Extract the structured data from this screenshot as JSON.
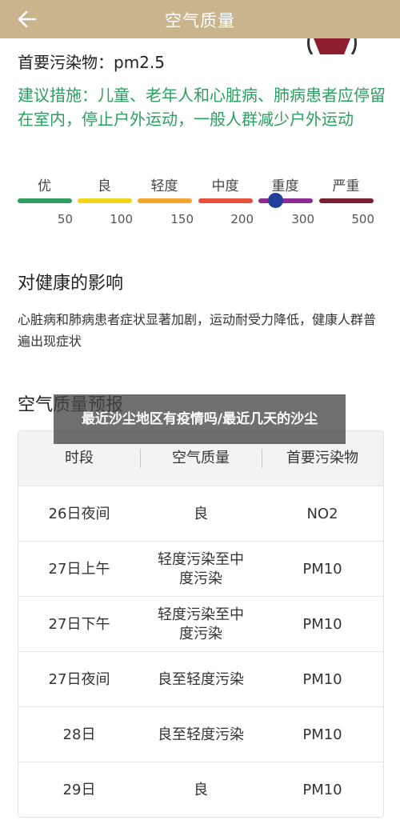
{
  "header": {
    "title": "空气质量",
    "back_icon": "back-arrow-icon"
  },
  "primary_pollutant": "首要污染物：pm2.5",
  "advice": "建议措施：儿童、老年人和心脏病、肺病患者应停留在室内，停止户外运动，一般人群减少户外运动",
  "levels": [
    {
      "label": "优",
      "color": "#2e9e63"
    },
    {
      "label": "良",
      "color": "#f0d51c"
    },
    {
      "label": "轻度",
      "color": "#f2a42f"
    },
    {
      "label": "中度",
      "color": "#e6503c"
    },
    {
      "label": "重度",
      "color": "#8e2a93"
    },
    {
      "label": "严重",
      "color": "#7a1f2e"
    }
  ],
  "ticks": [
    "50",
    "100",
    "150",
    "200",
    "300",
    "500"
  ],
  "current_aqi_level": "重度",
  "health_impact": {
    "title": "对健康的影响",
    "text": "心脏病和肺病患者症状显著加剧，运动耐受力降低，健康人群普遍出现症状"
  },
  "forecast": {
    "title": "空气质量预报",
    "columns": [
      "时段",
      "空气质量",
      "首要污染物"
    ],
    "rows": [
      [
        "26日夜间",
        "良",
        "NO2"
      ],
      [
        "27日上午",
        "轻度污染至中度污染",
        "PM10"
      ],
      [
        "27日下午",
        "轻度污染至中度污染",
        "PM10"
      ],
      [
        "27日夜间",
        "良至轻度污染",
        "PM10"
      ],
      [
        "28日",
        "良至轻度污染",
        "PM10"
      ],
      [
        "29日",
        "良",
        "PM10"
      ]
    ]
  },
  "overlay_text": "最近沙尘地区有疫情吗/最近几天的沙尘"
}
